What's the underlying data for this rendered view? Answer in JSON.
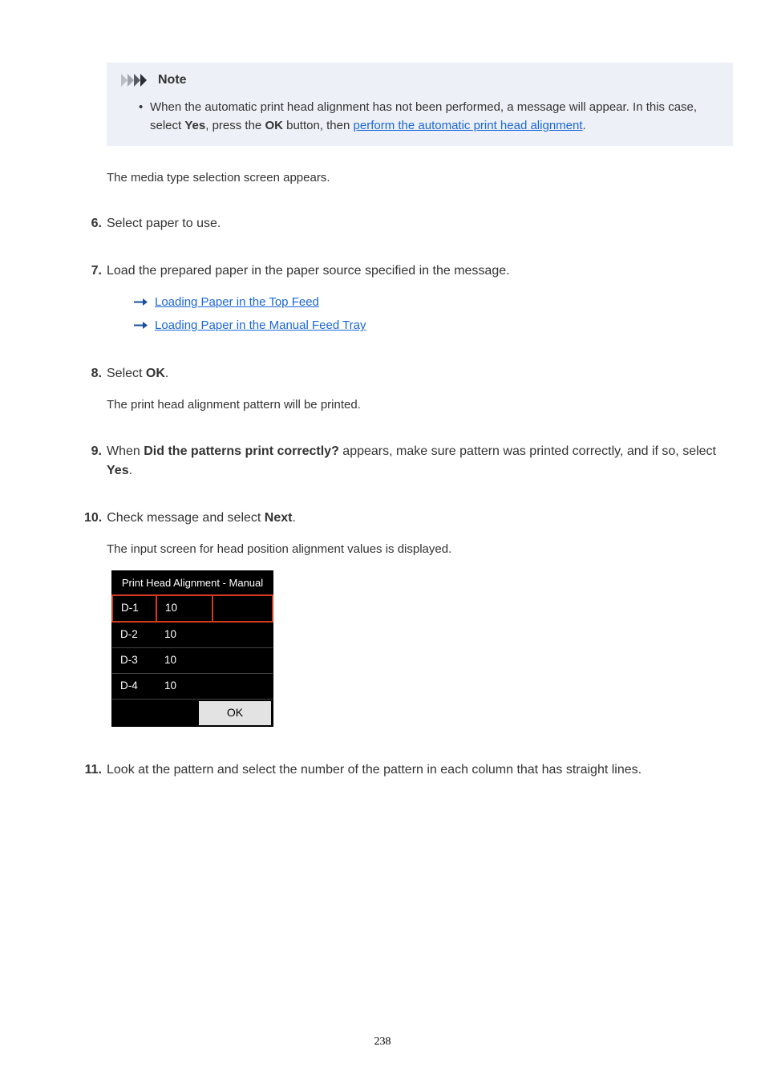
{
  "note": {
    "title": "Note",
    "bullet_pre": "When the automatic print head alignment has not been performed, a message will appear. In this case, select ",
    "bullet_b1": "Yes",
    "bullet_mid1": ", press the ",
    "bullet_b2": "OK",
    "bullet_mid2": " button, then ",
    "bullet_link": "perform the automatic print head alignment",
    "bullet_post": "."
  },
  "media_text": "The media type selection screen appears.",
  "steps": {
    "6": {
      "num": "6.",
      "text": "Select paper to use."
    },
    "7": {
      "num": "7.",
      "text": "Load the prepared paper in the paper source specified in the message.",
      "links": {
        "0": "Loading Paper in the Top Feed",
        "1": "Loading Paper in the Manual Feed Tray"
      }
    },
    "8": {
      "num": "8.",
      "pre": "Select ",
      "b": "OK",
      "post": ".",
      "after": "The print head alignment pattern will be printed."
    },
    "9": {
      "num": "9.",
      "pre": "When ",
      "b1": "Did the patterns print correctly?",
      "mid": " appears, make sure pattern was printed correctly, and if so, select ",
      "b2": "Yes",
      "post": "."
    },
    "10": {
      "num": "10.",
      "pre": "Check message and select ",
      "b": "Next",
      "post": ".",
      "after": "The input screen for head position alignment values is displayed."
    },
    "11": {
      "num": "11.",
      "text": "Look at the pattern and select the number of the pattern in each column that has straight lines."
    }
  },
  "device": {
    "title": "Print Head Alignment - Manual",
    "rows": [
      {
        "label": "D-1",
        "val": "10",
        "selected": true
      },
      {
        "label": "D-2",
        "val": "10",
        "selected": false
      },
      {
        "label": "D-3",
        "val": "10",
        "selected": false
      },
      {
        "label": "D-4",
        "val": "10",
        "selected": false
      }
    ],
    "ok": "OK"
  },
  "page_number": "238"
}
